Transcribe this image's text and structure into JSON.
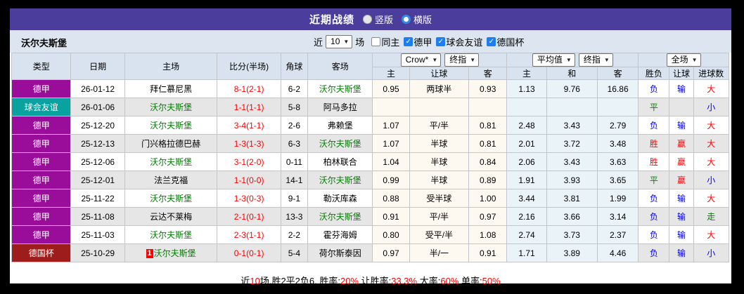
{
  "title_bar": {
    "title": "近期战绩",
    "view_options": [
      {
        "label": "竖版",
        "selected": false
      },
      {
        "label": "横版",
        "selected": true
      }
    ]
  },
  "filter_bar": {
    "team_name": "沃尔夫斯堡",
    "recent_prefix": "近",
    "recent_count": "10",
    "recent_suffix": "场",
    "checkboxes": [
      {
        "label": "同主",
        "checked": false
      },
      {
        "label": "德甲",
        "checked": true
      },
      {
        "label": "球会友谊",
        "checked": true
      },
      {
        "label": "德国杯",
        "checked": true
      }
    ]
  },
  "table": {
    "static_headers": [
      "类型",
      "日期",
      "主场",
      "比分(半场)",
      "角球",
      "客场"
    ],
    "group_selects": {
      "bookmaker": "Crow*",
      "bookmaker_stage": "终指",
      "average": "平均值",
      "average_stage": "终指",
      "scope": "全场"
    },
    "sub_headers": [
      "主",
      "让球",
      "客",
      "主",
      "和",
      "客",
      "胜负",
      "让球",
      "进球数"
    ],
    "league_colors": {
      "德甲": "#9a0d9a",
      "球会友谊": "#0aa29e",
      "德国杯": "#9d1d1d"
    },
    "result_colors": {
      "red": "#ff0000",
      "blue": "#0000ee",
      "green": "#008000"
    },
    "rows": [
      {
        "league": "德甲",
        "date": "26-01-12",
        "home": "拜仁慕尼黑",
        "home_is_team": false,
        "home_badge": "",
        "score": "8-1(2-1)",
        "corners": "6-2",
        "away": "沃尔夫斯堡",
        "away_is_team": true,
        "odds": [
          "0.95",
          "两球半",
          "0.93"
        ],
        "avg": [
          "1.13",
          "9.76",
          "16.86"
        ],
        "results": [
          {
            "t": "负",
            "c": "blue"
          },
          {
            "t": "输",
            "c": "blue"
          },
          {
            "t": "大",
            "c": "red"
          }
        ]
      },
      {
        "league": "球会友谊",
        "date": "26-01-06",
        "home": "沃尔夫斯堡",
        "home_is_team": true,
        "home_badge": "",
        "score": "1-1(1-1)",
        "corners": "5-8",
        "away": "阿马多拉",
        "away_is_team": false,
        "odds": [
          "",
          "",
          ""
        ],
        "avg": [
          "",
          "",
          ""
        ],
        "results": [
          {
            "t": "平",
            "c": "green"
          },
          {
            "t": "",
            "c": "blue"
          },
          {
            "t": "小",
            "c": "blue"
          }
        ]
      },
      {
        "league": "德甲",
        "date": "25-12-20",
        "home": "沃尔夫斯堡",
        "home_is_team": true,
        "home_badge": "",
        "score": "3-4(1-1)",
        "corners": "2-6",
        "away": "弗赖堡",
        "away_is_team": false,
        "odds": [
          "1.07",
          "平/半",
          "0.81"
        ],
        "avg": [
          "2.48",
          "3.43",
          "2.79"
        ],
        "results": [
          {
            "t": "负",
            "c": "blue"
          },
          {
            "t": "输",
            "c": "blue"
          },
          {
            "t": "大",
            "c": "red"
          }
        ]
      },
      {
        "league": "德甲",
        "date": "25-12-13",
        "home": "门兴格拉德巴赫",
        "home_is_team": false,
        "home_badge": "",
        "score": "1-3(1-3)",
        "corners": "6-3",
        "away": "沃尔夫斯堡",
        "away_is_team": true,
        "odds": [
          "1.07",
          "半球",
          "0.81"
        ],
        "avg": [
          "2.01",
          "3.72",
          "3.48"
        ],
        "results": [
          {
            "t": "胜",
            "c": "red"
          },
          {
            "t": "赢",
            "c": "red"
          },
          {
            "t": "大",
            "c": "red"
          }
        ]
      },
      {
        "league": "德甲",
        "date": "25-12-06",
        "home": "沃尔夫斯堡",
        "home_is_team": true,
        "home_badge": "",
        "score": "3-1(2-0)",
        "corners": "0-11",
        "away": "柏林联合",
        "away_is_team": false,
        "odds": [
          "1.04",
          "半球",
          "0.84"
        ],
        "avg": [
          "2.06",
          "3.43",
          "3.63"
        ],
        "results": [
          {
            "t": "胜",
            "c": "red"
          },
          {
            "t": "赢",
            "c": "red"
          },
          {
            "t": "大",
            "c": "red"
          }
        ]
      },
      {
        "league": "德甲",
        "date": "25-12-01",
        "home": "法兰克福",
        "home_is_team": false,
        "home_badge": "",
        "score": "1-1(0-0)",
        "corners": "14-1",
        "away": "沃尔夫斯堡",
        "away_is_team": true,
        "odds": [
          "0.99",
          "半球",
          "0.89"
        ],
        "avg": [
          "1.91",
          "3.93",
          "3.65"
        ],
        "results": [
          {
            "t": "平",
            "c": "green"
          },
          {
            "t": "赢",
            "c": "red"
          },
          {
            "t": "小",
            "c": "blue"
          }
        ]
      },
      {
        "league": "德甲",
        "date": "25-11-22",
        "home": "沃尔夫斯堡",
        "home_is_team": true,
        "home_badge": "",
        "score": "1-3(0-3)",
        "corners": "9-1",
        "away": "勒沃库森",
        "away_is_team": false,
        "odds": [
          "0.88",
          "受半球",
          "1.00"
        ],
        "avg": [
          "3.44",
          "3.81",
          "1.99"
        ],
        "results": [
          {
            "t": "负",
            "c": "blue"
          },
          {
            "t": "输",
            "c": "blue"
          },
          {
            "t": "大",
            "c": "red"
          }
        ]
      },
      {
        "league": "德甲",
        "date": "25-11-08",
        "home": "云达不莱梅",
        "home_is_team": false,
        "home_badge": "",
        "score": "2-1(0-1)",
        "corners": "13-3",
        "away": "沃尔夫斯堡",
        "away_is_team": true,
        "odds": [
          "0.91",
          "平/半",
          "0.97"
        ],
        "avg": [
          "2.16",
          "3.66",
          "3.14"
        ],
        "results": [
          {
            "t": "负",
            "c": "blue"
          },
          {
            "t": "输",
            "c": "blue"
          },
          {
            "t": "走",
            "c": "green"
          }
        ]
      },
      {
        "league": "德甲",
        "date": "25-11-03",
        "home": "沃尔夫斯堡",
        "home_is_team": true,
        "home_badge": "",
        "score": "2-3(1-1)",
        "corners": "2-2",
        "away": "霍芬海姆",
        "away_is_team": false,
        "odds": [
          "0.80",
          "受平/半",
          "1.08"
        ],
        "avg": [
          "2.74",
          "3.73",
          "2.37"
        ],
        "results": [
          {
            "t": "负",
            "c": "blue"
          },
          {
            "t": "输",
            "c": "blue"
          },
          {
            "t": "大",
            "c": "red"
          }
        ]
      },
      {
        "league": "德国杯",
        "date": "25-10-29",
        "home": "沃尔夫斯堡",
        "home_is_team": true,
        "home_badge": "1",
        "score": "0-1(0-1)",
        "corners": "5-4",
        "away": "荷尔斯泰因",
        "away_is_team": false,
        "odds": [
          "0.97",
          "半/一",
          "0.91"
        ],
        "avg": [
          "1.71",
          "3.89",
          "4.46"
        ],
        "results": [
          {
            "t": "负",
            "c": "blue"
          },
          {
            "t": "输",
            "c": "blue"
          },
          {
            "t": "小",
            "c": "blue"
          }
        ]
      }
    ]
  },
  "summary": {
    "segments": [
      {
        "text": "近",
        "color": "black"
      },
      {
        "text": "10",
        "color": "red"
      },
      {
        "text": "场,胜2平2负6, 胜率:",
        "color": "black"
      },
      {
        "text": "20%",
        "color": "red"
      },
      {
        "text": " 让胜率:",
        "color": "black"
      },
      {
        "text": "33.3%",
        "color": "red"
      },
      {
        "text": " 大率:",
        "color": "black"
      },
      {
        "text": "60%",
        "color": "red"
      },
      {
        "text": " 单率:",
        "color": "black"
      },
      {
        "text": "50%",
        "color": "red"
      }
    ]
  }
}
